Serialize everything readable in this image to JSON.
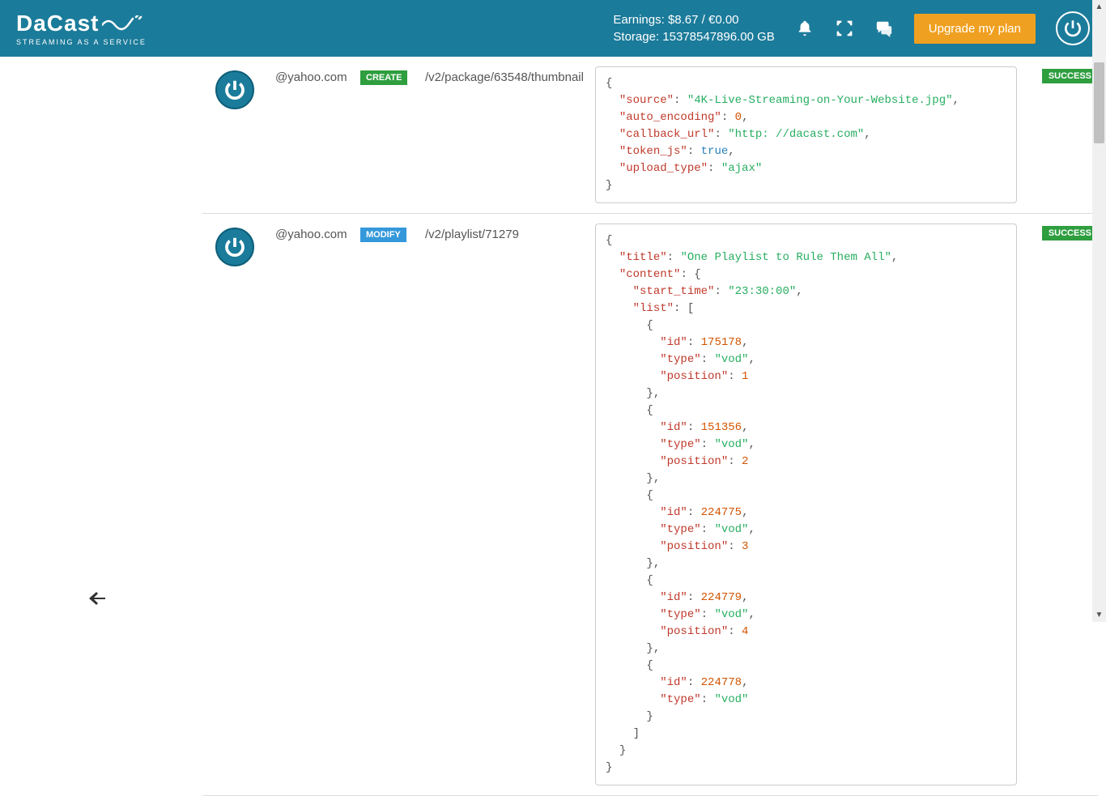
{
  "header": {
    "logo_text": "DaCast",
    "logo_tagline": "STREAMING AS A SERVICE",
    "earnings_label": "Earnings:",
    "earnings_value": "$8.67 / €0.00",
    "storage_label": "Storage:",
    "storage_value": "15378547896.00 GB",
    "upgrade_label": "Upgrade my plan"
  },
  "rows": [
    {
      "email": "@yahoo.com",
      "operation": "CREATE",
      "op_class": "op-create",
      "path": "/v2/package/63548/thumbnail",
      "status": "SUCCESS",
      "json": {
        "source": "4K-Live-Streaming-on-Your-Website.jpg",
        "auto_encoding": 0,
        "callback_url": "http: //dacast.com",
        "token_js": true,
        "upload_type": "ajax"
      }
    },
    {
      "email": "@yahoo.com",
      "operation": "MODIFY",
      "op_class": "op-modify",
      "path": "/v2/playlist/71279",
      "status": "SUCCESS",
      "json": {
        "title": "One Playlist to Rule Them All",
        "content": {
          "start_time": "23:30:00",
          "list": [
            {
              "id": 175178,
              "type": "vod",
              "position": 1
            },
            {
              "id": 151356,
              "type": "vod",
              "position": 2
            },
            {
              "id": 224775,
              "type": "vod",
              "position": 3
            },
            {
              "id": 224779,
              "type": "vod",
              "position": 4
            },
            {
              "id": 224778,
              "type": "vod"
            }
          ]
        }
      }
    }
  ]
}
